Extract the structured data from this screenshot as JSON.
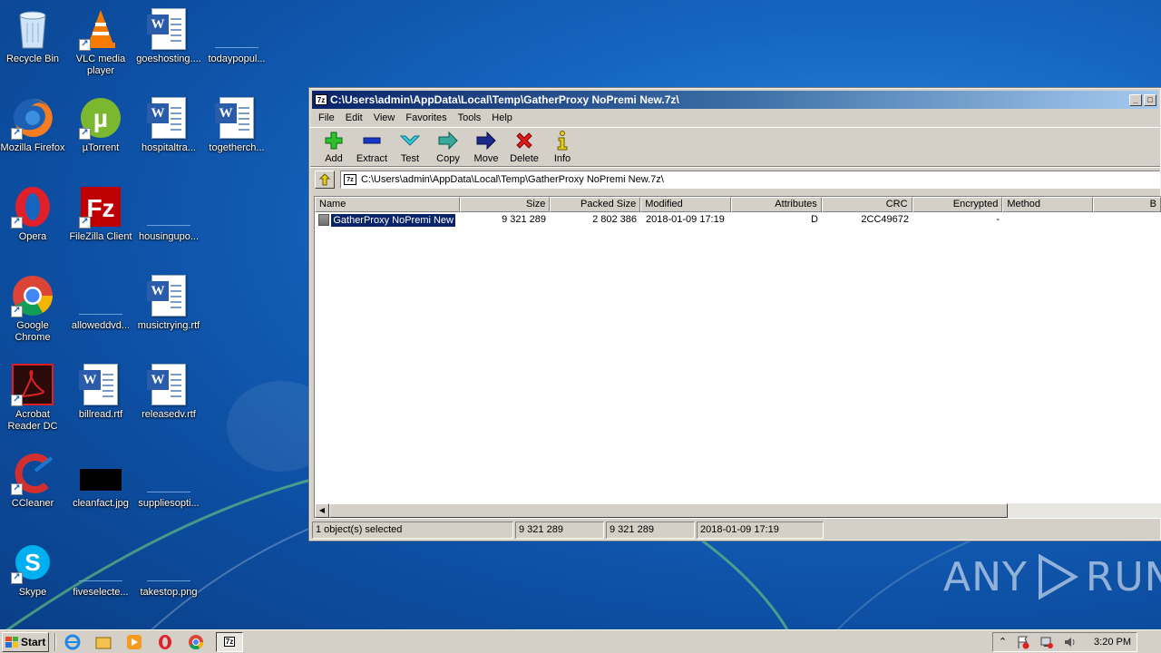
{
  "desktop": {
    "icons": [
      {
        "label": "Recycle Bin",
        "icon": "recycle-bin-icon"
      },
      {
        "label": "VLC media player",
        "icon": "vlc-icon"
      },
      {
        "label": "goeshosting....",
        "icon": "word-document-icon"
      },
      {
        "label": "todaypopul...",
        "icon": "blank-image-icon"
      },
      {
        "label": "Mozilla Firefox",
        "icon": "firefox-icon"
      },
      {
        "label": "µTorrent",
        "icon": "utorrent-icon"
      },
      {
        "label": "hospitaltra...",
        "icon": "word-document-icon"
      },
      {
        "label": "togetherch...",
        "icon": "word-document-icon"
      },
      {
        "label": "Opera",
        "icon": "opera-icon"
      },
      {
        "label": "FileZilla Client",
        "icon": "filezilla-icon"
      },
      {
        "label": "housingupo...",
        "icon": "blank-image-icon"
      },
      {
        "label": "Google Chrome",
        "icon": "chrome-icon"
      },
      {
        "label": "alloweddvd...",
        "icon": "blank-image-icon"
      },
      {
        "label": "musictrying.rtf",
        "icon": "word-document-icon"
      },
      {
        "label": "Acrobat Reader DC",
        "icon": "acrobat-icon"
      },
      {
        "label": "billread.rtf",
        "icon": "word-document-icon"
      },
      {
        "label": "releasedv.rtf",
        "icon": "word-document-icon"
      },
      {
        "label": "CCleaner",
        "icon": "ccleaner-icon"
      },
      {
        "label": "cleanfact.jpg",
        "icon": "black-image-icon"
      },
      {
        "label": "suppliesopti...",
        "icon": "blank-image-icon"
      },
      {
        "label": "Skype",
        "icon": "skype-icon"
      },
      {
        "label": "fiveselecte...",
        "icon": "blank-image-icon"
      },
      {
        "label": "takestop.png",
        "icon": "blank-image-icon"
      }
    ]
  },
  "window": {
    "title": "C:\\Users\\admin\\AppData\\Local\\Temp\\GatherProxy NoPremi New.7z\\",
    "app_icon_text": "7z",
    "menu": [
      "File",
      "Edit",
      "View",
      "Favorites",
      "Tools",
      "Help"
    ],
    "toolbar": [
      {
        "label": "Add",
        "icon": "add-icon"
      },
      {
        "label": "Extract",
        "icon": "extract-icon"
      },
      {
        "label": "Test",
        "icon": "test-icon"
      },
      {
        "label": "Copy",
        "icon": "copy-icon"
      },
      {
        "label": "Move",
        "icon": "move-icon"
      },
      {
        "label": "Delete",
        "icon": "delete-icon"
      },
      {
        "label": "Info",
        "icon": "info-icon"
      }
    ],
    "address": "C:\\Users\\admin\\AppData\\Local\\Temp\\GatherProxy NoPremi New.7z\\",
    "columns": [
      "Name",
      "Size",
      "Packed Size",
      "Modified",
      "Attributes",
      "CRC",
      "Encrypted",
      "Method",
      "B"
    ],
    "rows": [
      {
        "name": "GatherProxy NoPremi New",
        "size": "9 321 289",
        "packed_size": "2 802 386",
        "modified": "2018-01-09 17:19",
        "attributes": "D",
        "crc": "2CC49672",
        "encrypted": "-",
        "method": ""
      }
    ],
    "status": {
      "selection": "1 object(s) selected",
      "size": "9 321 289",
      "packed": "9 321 289",
      "date": "2018-01-09 17:19"
    }
  },
  "taskbar": {
    "start_label": "Start",
    "active_task_text": "7z",
    "clock": "3:20 PM"
  },
  "watermark": {
    "left": "ANY",
    "right": "RUN"
  },
  "colors": {
    "title_gradient_start": "#0a246a",
    "title_gradient_end": "#a6caf0",
    "selection": "#0a246a"
  }
}
